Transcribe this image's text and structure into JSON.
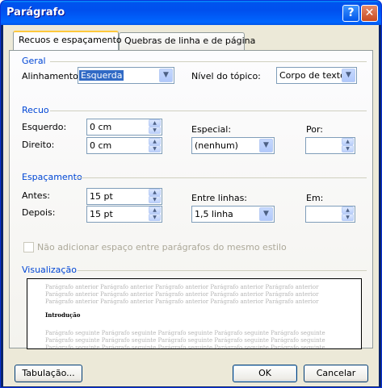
{
  "window": {
    "title": "Parágrafo"
  },
  "tabs": [
    {
      "label": "Recuos e espaçamento"
    },
    {
      "label": "Quebras de linha e de página"
    }
  ],
  "geral": {
    "title": "Geral",
    "alinhamento_label": "Alinhamento:",
    "alinhamento_value": "Esquerda",
    "nivel_label": "Nível do tópico:",
    "nivel_value": "Corpo de texto"
  },
  "recuo": {
    "title": "Recuo",
    "esquerdo_label": "Esquerdo:",
    "esquerdo_value": "0 cm",
    "direito_label": "Direito:",
    "direito_value": "0 cm",
    "especial_label": "Especial:",
    "especial_value": "(nenhum)",
    "por_label": "Por:",
    "por_value": ""
  },
  "espacamento": {
    "title": "Espaçamento",
    "antes_label": "Antes:",
    "antes_value": "15 pt",
    "depois_label": "Depois:",
    "depois_value": "15 pt",
    "entre_linhas_label": "Entre linhas:",
    "entre_linhas_value": "1,5 linha",
    "em_label": "Em:",
    "em_value": "",
    "nao_adicionar_label": "Não adicionar espaço entre parágrafos do mesmo estilo",
    "nao_adicionar_checked": false
  },
  "visualizacao": {
    "title": "Visualização",
    "prev_line": "Parágrafo anterior Parágrafo anterior Parágrafo anterior Parágrafo anterior Parágrafo anterior",
    "current": "Introdução",
    "next_line": "Parágrafo seguinte Parágrafo seguinte Parágrafo seguinte Parágrafo seguinte Parágrafo seguinte"
  },
  "buttons": {
    "tabulacao": "Tabulação...",
    "ok": "OK",
    "cancelar": "Cancelar"
  },
  "titlebar_buttons": {
    "help": "?",
    "close": "✕"
  }
}
